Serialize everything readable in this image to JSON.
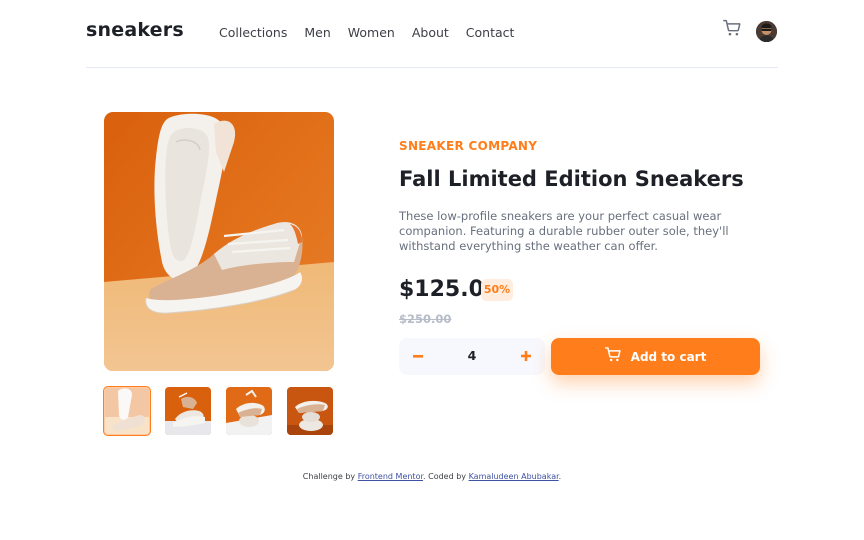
{
  "header": {
    "logo": "sneakers",
    "nav": [
      "Collections",
      "Men",
      "Women",
      "About",
      "Contact"
    ],
    "cart_icon": "cart-icon",
    "avatar_icon": "avatar"
  },
  "gallery": {
    "main_image": "sneaker-product-image",
    "thumbnails": [
      "thumbnail-1",
      "thumbnail-2",
      "thumbnail-3",
      "thumbnail-4"
    ],
    "active_thumbnail": 1
  },
  "product": {
    "company": "SNEAKER COMPANY",
    "title": "Fall Limited Edition Sneakers",
    "description": "These low-profile sneakers are your perfect casual wear companion. Featuring a durable rubber outer sole, they'll withstand everything sthe weather can offer.",
    "price": "$125.00",
    "discount": "50%",
    "old_price": "$250.00",
    "quantity": "4",
    "add_to_cart": "Add to cart"
  },
  "footer": {
    "prefix": "Challenge by",
    "link1": "Frontend Mentor",
    "middle": ". Coded by",
    "link2": "Kamaludeen Abubakar",
    "suffix": "."
  },
  "colors": {
    "accent": "#ff7e1b",
    "accent_pale": "#ffede0",
    "dark": "#1d2026",
    "gray": "#68707d"
  }
}
